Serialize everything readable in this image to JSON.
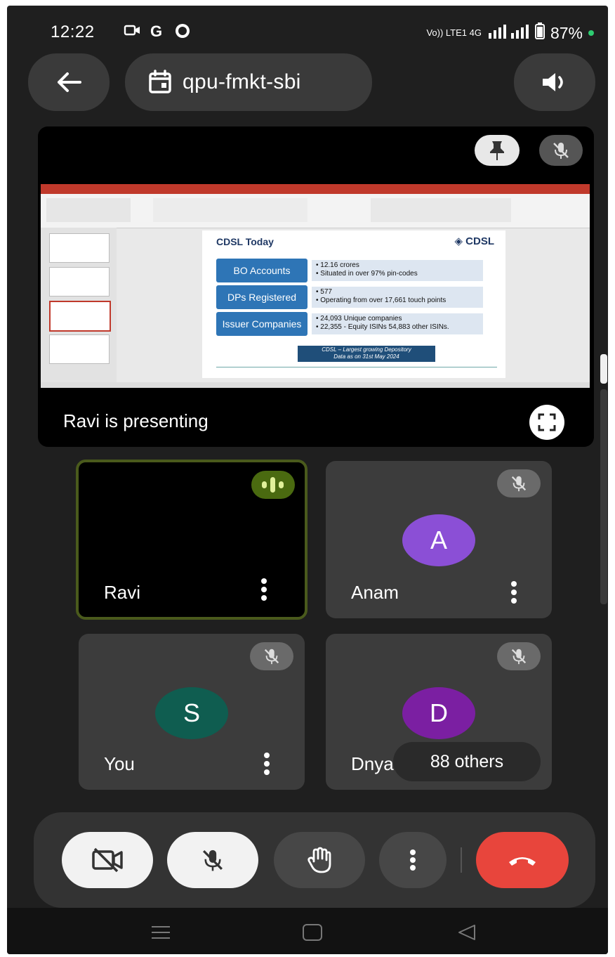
{
  "status_bar": {
    "time": "12:22",
    "g_label": "G",
    "network": "Vo)) LTE1 4G",
    "battery": "87%",
    "accent_dot_color": "#2ecc71"
  },
  "header": {
    "back_icon": "arrow-left-icon",
    "meeting_code": "qpu-fmkt-sbi",
    "calendar_icon": "calendar-icon",
    "speaker_icon": "speaker-icon"
  },
  "presentation": {
    "presenting_text": "Ravi is presenting",
    "slide": {
      "title": "CDSL Today",
      "logo": "◈ CDSL",
      "rows": [
        {
          "label": "BO Accounts",
          "items": [
            "• 12.16 crores",
            "• Situated in over 97% pin-codes"
          ]
        },
        {
          "label": "DPs Registered",
          "items": [
            "• 577",
            "• Operating from over 17,661 touch points"
          ]
        },
        {
          "label": "Issuer Companies",
          "items": [
            "• 24,093 Unique companies",
            "• 22,355 - Equity ISINs 54,883 other ISINs."
          ]
        }
      ],
      "banner_line1": "CDSL – Largest growing Depository",
      "banner_line2": "Data as on 31st May 2024"
    }
  },
  "participants": [
    {
      "name": "Ravi",
      "initial": "",
      "speaking": true
    },
    {
      "name": "Anam",
      "initial": "A",
      "avatar_color": "#8b4fd6"
    },
    {
      "name": "You",
      "initial": "S",
      "avatar_color": "#0f5d50"
    },
    {
      "name": "Dnya",
      "initial": "D",
      "avatar_color": "#7b1fa2"
    }
  ],
  "others_label": "88 others",
  "controls": {
    "camera_icon": "camera-off-icon",
    "mic_icon": "mic-off-icon",
    "hand_icon": "raise-hand-icon",
    "more_icon": "more-vertical-icon",
    "end_call_icon": "end-call-icon",
    "end_call_color": "#e8453c"
  }
}
